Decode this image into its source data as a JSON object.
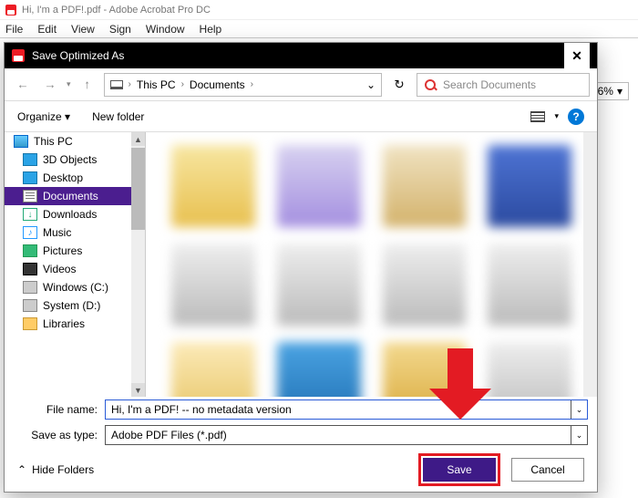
{
  "host": {
    "title": "Hi, I'm a PDF!.pdf - Adobe Acrobat Pro DC",
    "menu": [
      "File",
      "Edit",
      "View",
      "Sign",
      "Window",
      "Help"
    ],
    "stray_zoom": "6%"
  },
  "dialog": {
    "title": "Save Optimized As",
    "breadcrumb": {
      "root": "This PC",
      "folder": "Documents"
    },
    "search_placeholder": "Search Documents",
    "organize": "Organize",
    "newfolder": "New folder",
    "tree": [
      {
        "label": "This PC",
        "icon": "pc",
        "root": true
      },
      {
        "label": "3D Objects",
        "icon": "cube"
      },
      {
        "label": "Desktop",
        "icon": "desk"
      },
      {
        "label": "Documents",
        "icon": "doc",
        "selected": true
      },
      {
        "label": "Downloads",
        "icon": "dl"
      },
      {
        "label": "Music",
        "icon": "music"
      },
      {
        "label": "Pictures",
        "icon": "pic"
      },
      {
        "label": "Videos",
        "icon": "vid"
      },
      {
        "label": "Windows (C:)",
        "icon": "drive"
      },
      {
        "label": "System (D:)",
        "icon": "drive"
      },
      {
        "label": "Libraries",
        "icon": "folder"
      }
    ],
    "filename_label": "File name:",
    "filename_value": "Hi, I'm a PDF! -- no metadata version",
    "saveastype_label": "Save as type:",
    "saveastype_value": "Adobe PDF Files (*.pdf)",
    "hide_folders": "Hide Folders",
    "save": "Save",
    "cancel": "Cancel"
  }
}
